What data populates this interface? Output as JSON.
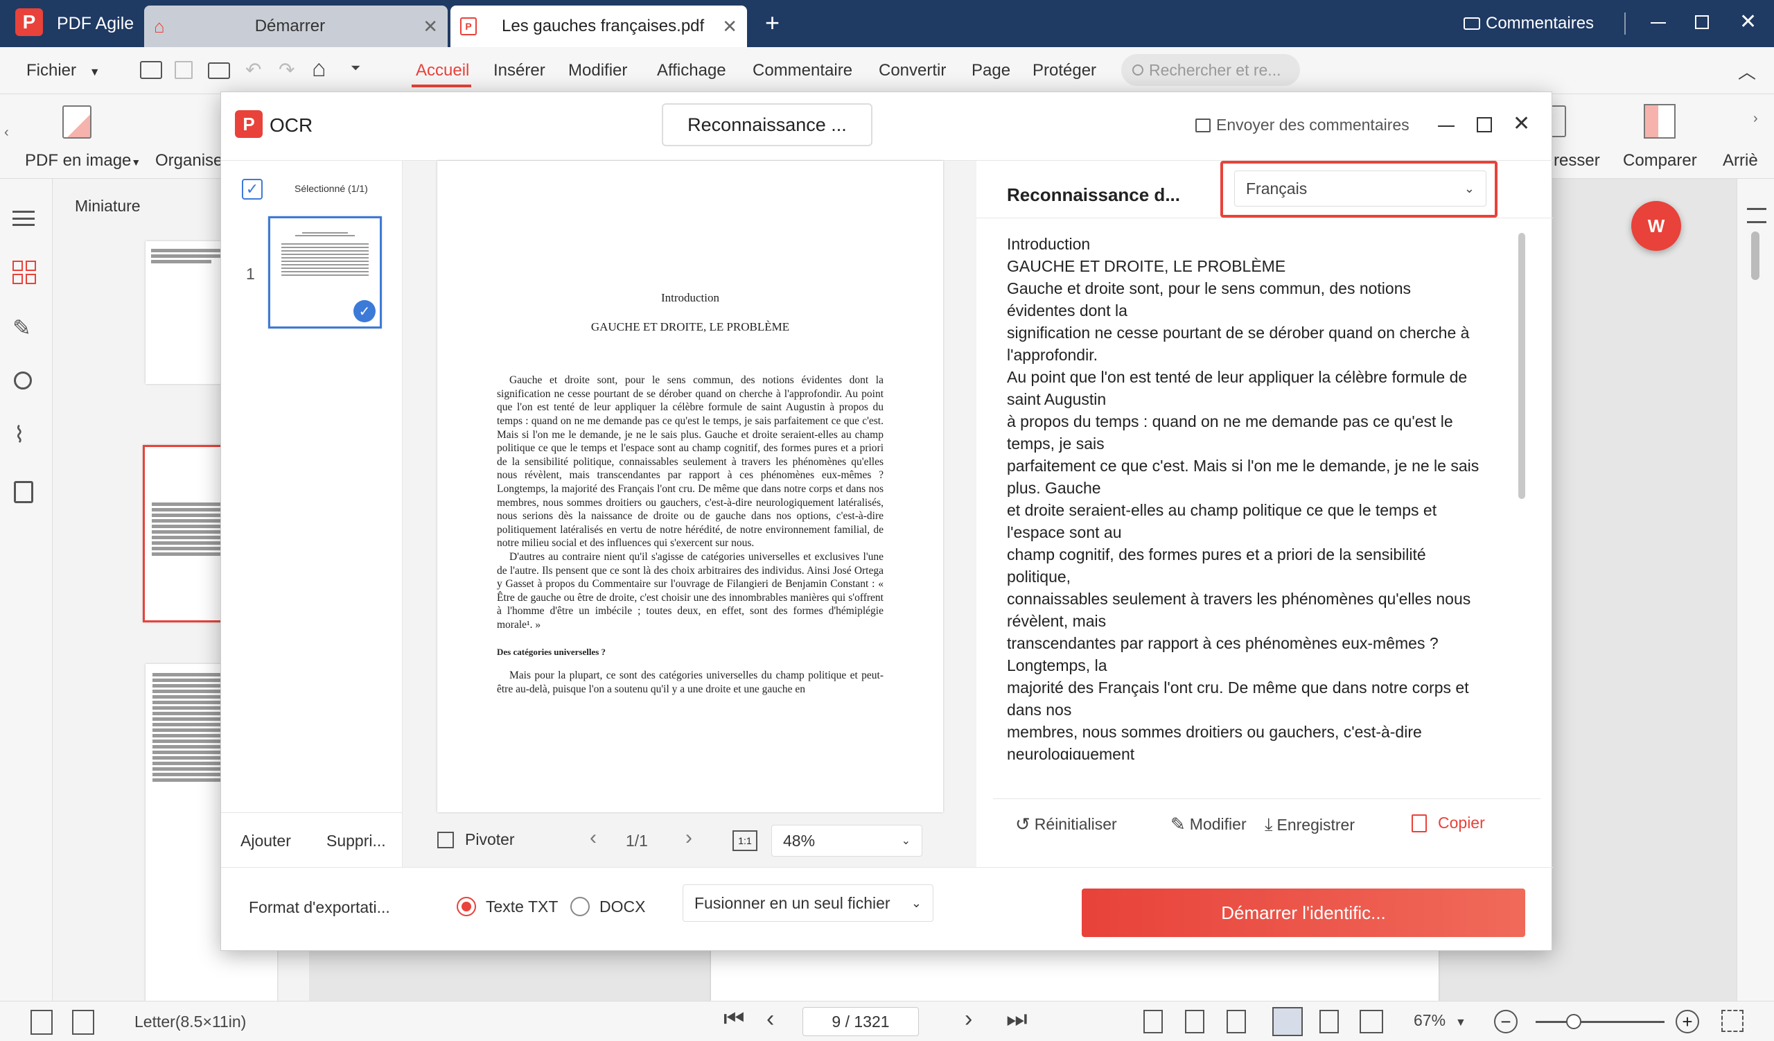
{
  "titlebar": {
    "app_name": "PDF Agile",
    "tabs": [
      {
        "label": "Démarrer"
      },
      {
        "label": "Les gauches françaises.pdf"
      }
    ],
    "comments_label": "Commentaires"
  },
  "menubar": {
    "file_label": "Fichier",
    "items": [
      "Accueil",
      "Insérer",
      "Modifier",
      "Affichage",
      "Commentaire",
      "Convertir",
      "Page",
      "Protéger"
    ],
    "search_placeholder": "Rechercher et re..."
  },
  "ribbon": {
    "pdf_to_image": "PDF en image",
    "organise": "Organise",
    "compress": "resser",
    "compare": "Comparer",
    "arriere": "Arriè"
  },
  "sidepanel": {
    "title": "Miniature"
  },
  "dialog": {
    "title": "OCR",
    "mode_button": "Reconnaissance ...",
    "feedback": "Envoyer des commentaires",
    "selected_label": "Sélectionné (1/1)",
    "page_number": "1",
    "add": "Ajouter",
    "delete": "Suppri...",
    "rotate": "Pivoter",
    "page_indicator": "1/1",
    "zoom": "48%",
    "recognition_title": "Reconnaissance d...",
    "language": "Français",
    "reset": "Réinitialiser",
    "edit": "Modifier",
    "save": "Enregistrer",
    "copy": "Copier",
    "export_format_label": "Format d'exportati...",
    "option_txt": "Texte TXT",
    "option_docx": "DOCX",
    "merge_select": "Fusionner en un seul fichier",
    "start_button": "Démarrer l'identific...",
    "ocr_lines": [
      "Introduction",
      "GAUCHE ET DROITE, LE PROBLÈME",
      "Gauche et droite sont, pour le sens commun, des notions",
      "évidentes dont la",
      "signification ne cesse pourtant de se dérober quand on cherche à",
      "l'approfondir.",
      "Au point que l'on est tenté de leur appliquer la célèbre formule de",
      "saint Augustin",
      "à propos du temps : quand on ne me demande pas ce qu'est le",
      "temps, je sais",
      "parfaitement ce que c'est. Mais si l'on me le demande, je ne le sais",
      "plus. Gauche",
      "et droite seraient-elles au champ politique ce que le temps et",
      "l'espace sont au",
      "champ cognitif, des formes pures et a priori de la sensibilité",
      "politique,",
      "connaissables seulement à travers les phénomènes qu'elles nous",
      "révèlent, mais",
      "transcendantes par rapport à ces phénomènes eux-mêmes ?",
      "Longtemps, la",
      "majorité des Français l'ont cru. De même que dans notre corps et",
      "dans nos",
      "membres, nous sommes droitiers ou gauchers, c'est-à-dire",
      "neurologiquement"
    ],
    "preview": {
      "heading1": "Introduction",
      "heading2": "GAUCHE ET DROITE, LE PROBLÈME",
      "para1": "Gauche et droite sont, pour le sens commun, des notions évidentes dont la signification ne cesse pourtant de se dérober quand on cherche à l'approfondir. Au point que l'on est tenté de leur appliquer la célèbre formule de saint Augustin à propos du temps : quand on ne me demande pas ce qu'est le temps, je sais parfaitement ce que c'est. Mais si l'on me le demande, je ne le sais plus. Gauche et droite seraient-elles au champ politique ce que le temps et l'espace sont au champ cognitif, des formes pures et a priori de la sensibilité politique, connaissables seulement à travers les phénomènes qu'elles nous révèlent, mais transcendantes par rapport à ces phénomènes eux-mêmes ? Longtemps, la majorité des Français l'ont cru. De même que dans notre corps et dans nos membres, nous sommes droitiers ou gauchers, c'est-à-dire neurologiquement latéralisés, nous serions dès la naissance de droite ou de gauche dans nos options, c'est-à-dire politiquement latéralisés en vertu de notre hérédité, de notre environnement familial, de notre milieu social et des influences qui s'exercent sur nous.",
      "para2": "D'autres au contraire nient qu'il s'agisse de catégories universelles et exclusives l'une de l'autre. Ils pensent que ce sont là des choix arbitraires des individus. Ainsi José Ortega y Gasset à propos du Commentaire sur l'ouvrage de Filangieri de Benjamin Constant : « Être de gauche ou être de droite, c'est choisir une des innombrables manières qui s'offrent à l'homme d'être un imbécile ; toutes deux, en effet, sont des formes d'hémiplégie morale¹. »",
      "subheading": "Des catégories universelles ?",
      "para3": "Mais pour la plupart, ce sont des catégories universelles du champ politique et peut-être au-delà, puisque l'on a soutenu qu'il y a une droite et une gauche en"
    }
  },
  "status": {
    "paper": "Letter(8.5×11in)",
    "page": "9 / 1321",
    "zoom": "67%"
  },
  "colors": {
    "titlebar": "#1f3a63",
    "accent": "#e8423a"
  }
}
